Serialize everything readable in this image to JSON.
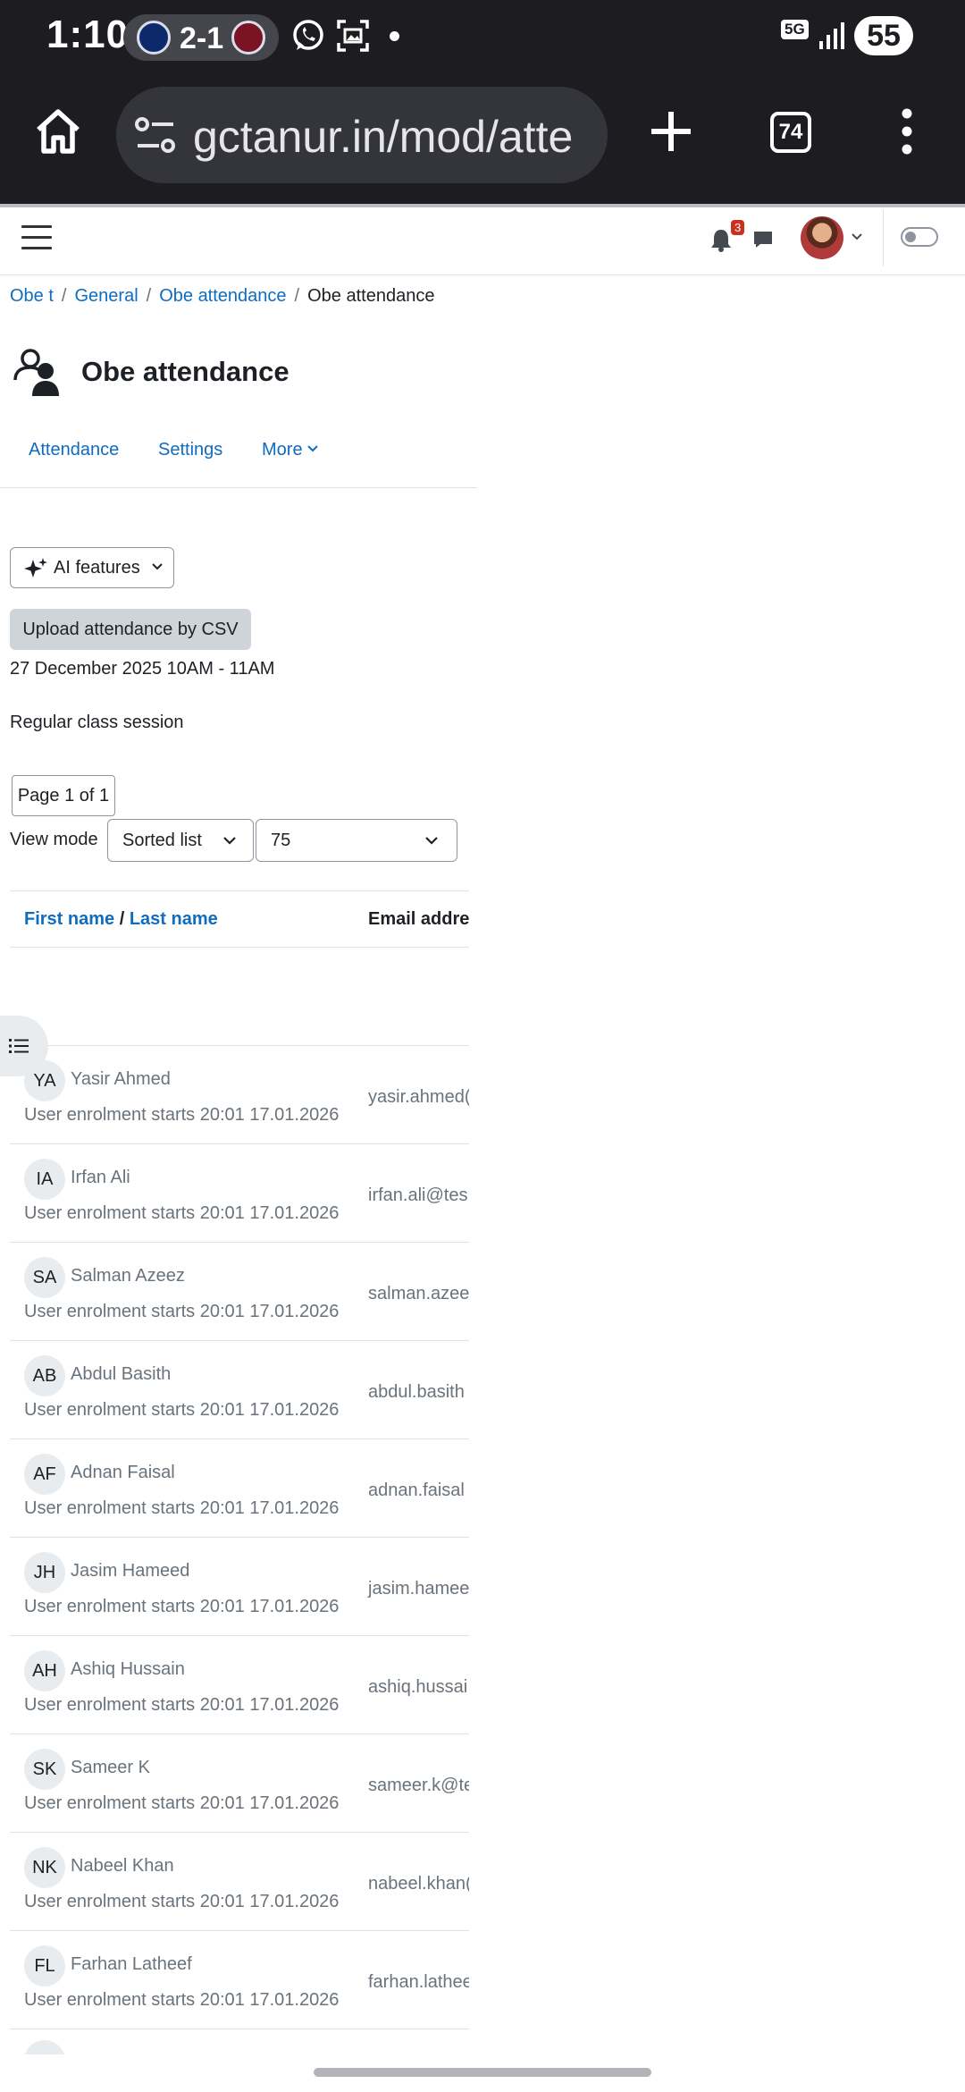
{
  "status_bar": {
    "time": "1:10",
    "score": "2-1",
    "network": "5G",
    "battery": "55"
  },
  "browser": {
    "url": "gctanur.in/mod/atte",
    "tab_count": "74"
  },
  "navbar": {
    "notification_count": "3"
  },
  "breadcrumb": [
    {
      "label": "Obe t"
    },
    {
      "label": "General"
    },
    {
      "label": "Obe attendance"
    },
    {
      "label": "Obe attendance"
    }
  ],
  "page": {
    "title": "Obe attendance",
    "secondary_nav": {
      "attendance": "Attendance",
      "settings": "Settings",
      "more": "More"
    },
    "ai_button": "AI features",
    "upload_button": "Upload attendance by CSV",
    "session_date": "27 December 2025 10AM - 11AM",
    "session_description": "Regular class session",
    "paging": "Page 1 of 1",
    "view_mode_label": "View mode",
    "view_mode_value": "Sorted list",
    "per_page_value": "75"
  },
  "table": {
    "header": {
      "first_name": "First name",
      "slash": " / ",
      "last_name": "Last name",
      "email": "Email address"
    },
    "rows": [
      {
        "initials": "YA",
        "name": "Yasir Ahmed",
        "enrolment": "User enrolment starts 20:01 17.01.2026",
        "email": "yasir.ahmed("
      },
      {
        "initials": "IA",
        "name": "Irfan Ali",
        "enrolment": "User enrolment starts 20:01 17.01.2026",
        "email": "irfan.ali@tes"
      },
      {
        "initials": "SA",
        "name": "Salman Azeez",
        "enrolment": "User enrolment starts 20:01 17.01.2026",
        "email": "salman.azee"
      },
      {
        "initials": "AB",
        "name": "Abdul Basith",
        "enrolment": "User enrolment starts 20:01 17.01.2026",
        "email": "abdul.basith"
      },
      {
        "initials": "AF",
        "name": "Adnan Faisal",
        "enrolment": "User enrolment starts 20:01 17.01.2026",
        "email": "adnan.faisal"
      },
      {
        "initials": "JH",
        "name": "Jasim Hameed",
        "enrolment": "User enrolment starts 20:01 17.01.2026",
        "email": "jasim.hamee"
      },
      {
        "initials": "AH",
        "name": "Ashiq Hussain",
        "enrolment": "User enrolment starts 20:01 17.01.2026",
        "email": "ashiq.hussai"
      },
      {
        "initials": "SK",
        "name": "Sameer K",
        "enrolment": "User enrolment starts 20:01 17.01.2026",
        "email": "sameer.k@te"
      },
      {
        "initials": "NK",
        "name": "Nabeel Khan",
        "enrolment": "User enrolment starts 20:01 17.01.2026",
        "email": "nabeel.khan("
      },
      {
        "initials": "FL",
        "name": "Farhan Latheef",
        "enrolment": "User enrolment starts 20:01 17.01.2026",
        "email": "farhan.lathee"
      }
    ]
  },
  "colors": {
    "link": "#0f6cbf",
    "chrome_bg": "#1c1c21",
    "badge": "#ca3120"
  }
}
